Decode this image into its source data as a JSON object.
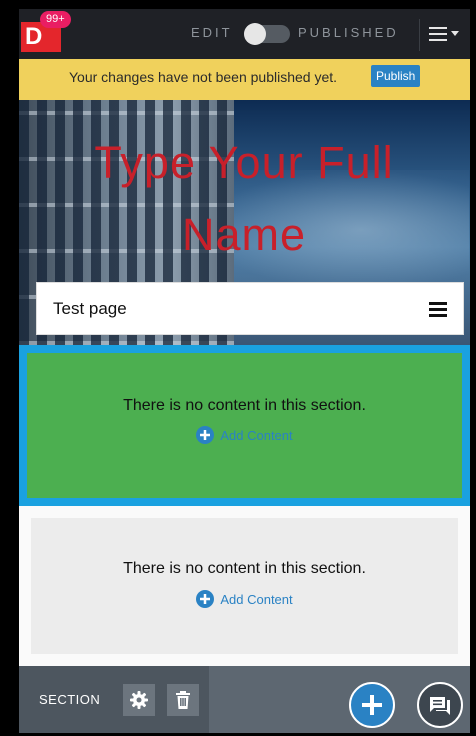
{
  "topbar": {
    "logo_letter": "D",
    "notification_count": "99+",
    "edit_label": "EDIT",
    "published_label": "PUBLISHED",
    "icons": {
      "menu": "hamburger-icon",
      "caret": "caret-down-icon"
    }
  },
  "banner": {
    "message": "Your changes have not been published yet.",
    "publish_label": "Publish"
  },
  "hero": {
    "title": "Type Your Full Name",
    "page_title": "Test page",
    "colors": {
      "title": "#c8202a"
    }
  },
  "sections": [
    {
      "empty_message": "There is no content in this section.",
      "add_label": "Add Content",
      "background": "#4caf50",
      "selected": true
    },
    {
      "empty_message": "There is no content in this section.",
      "add_label": "Add Content",
      "background": "#ececec",
      "selected": false
    }
  ],
  "toolbar": {
    "section_label": "SECTION",
    "icons": {
      "settings": "gear-icon",
      "delete": "trash-icon",
      "add": "plus-icon",
      "chat": "chat-icon"
    }
  },
  "colors": {
    "accent": "#2a82c4",
    "selection": "#1aa1e0",
    "banner": "#f0d15c",
    "badge": "#e91e63"
  }
}
